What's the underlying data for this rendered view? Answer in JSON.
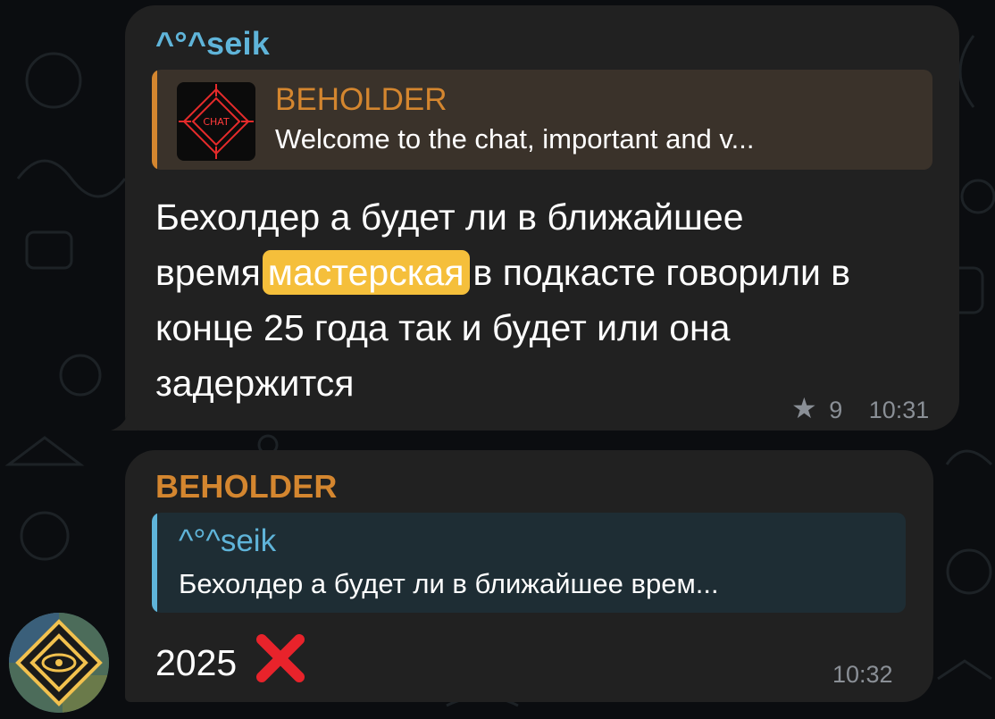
{
  "messages": [
    {
      "sender": "^°^seik",
      "reply": {
        "name": "BEHOLDER",
        "text": "Welcome to the chat, important and v...",
        "thumb_label": "CHAT"
      },
      "text_before": "Бехолдер  а будет ли в ближайшее время",
      "highlight": "мастерская",
      "text_after": "в подкасте говорили в конце 25 года так и будет или она задержится",
      "reactions": "9",
      "time": "10:31"
    },
    {
      "sender": "BEHOLDER",
      "reply": {
        "name": "^°^seik",
        "text": "Бехолдер а будет ли в ближайшее врем..."
      },
      "text": "2025",
      "emoji": "cross-mark-emoji",
      "time": "10:32"
    }
  ],
  "colors": {
    "bubble": "#212121",
    "seik": "#5fb4d9",
    "beholder": "#d4862f",
    "highlight": "#f5bf3b",
    "meta": "#8a8f96"
  }
}
